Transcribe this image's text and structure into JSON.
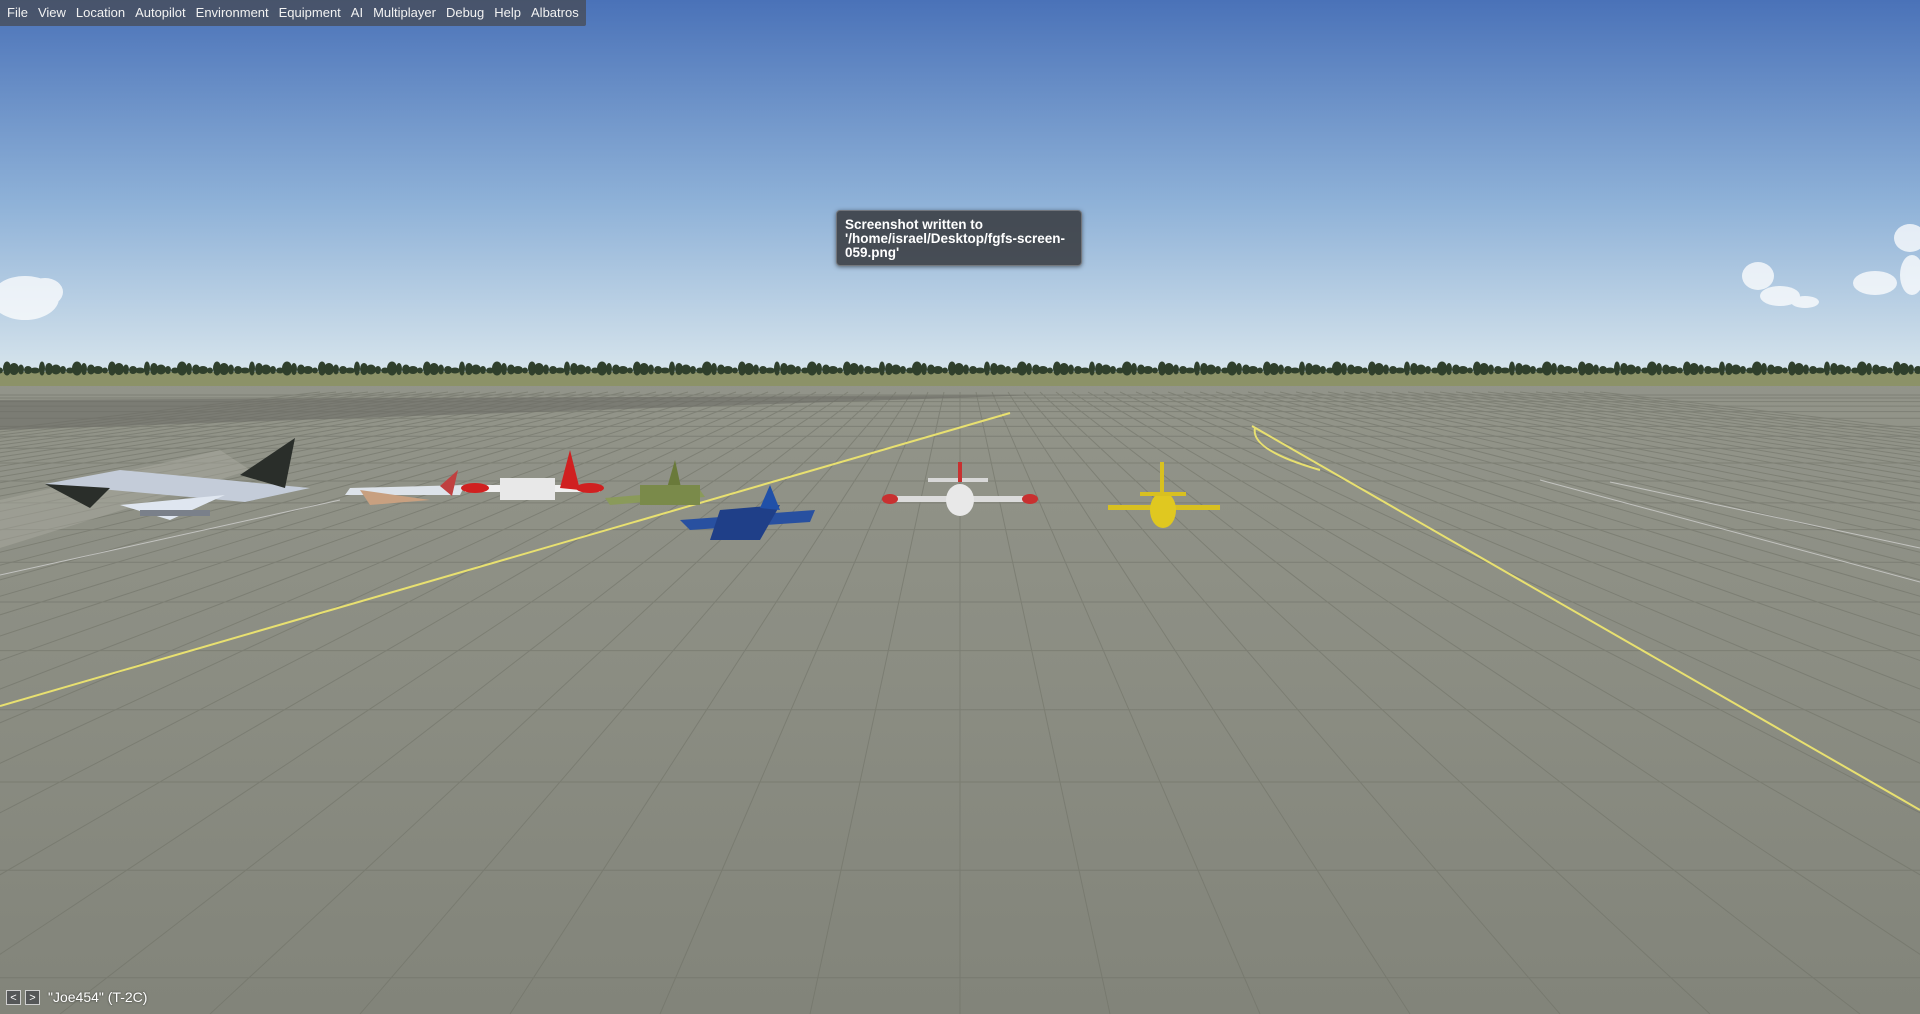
{
  "menubar": {
    "items": [
      "File",
      "View",
      "Location",
      "Autopilot",
      "Environment",
      "Equipment",
      "AI",
      "Multiplayer",
      "Debug",
      "Help",
      "Albatros"
    ]
  },
  "popup": {
    "lines": [
      "Screenshot written to",
      "'/home/israel/Desktop/fgfs-screen-",
      "059.png'"
    ]
  },
  "multiplayer_view": {
    "prev_label": "<",
    "next_label": ">",
    "pilot_label": "\"Joe454\" (T-2C)"
  },
  "colors": {
    "sky_top": "#4a72b8",
    "sky_horizon": "#cfe0ea",
    "tarmac": "#8a8b7e",
    "taxi_line": "#e8e070",
    "menu_bg": "#46484e"
  }
}
